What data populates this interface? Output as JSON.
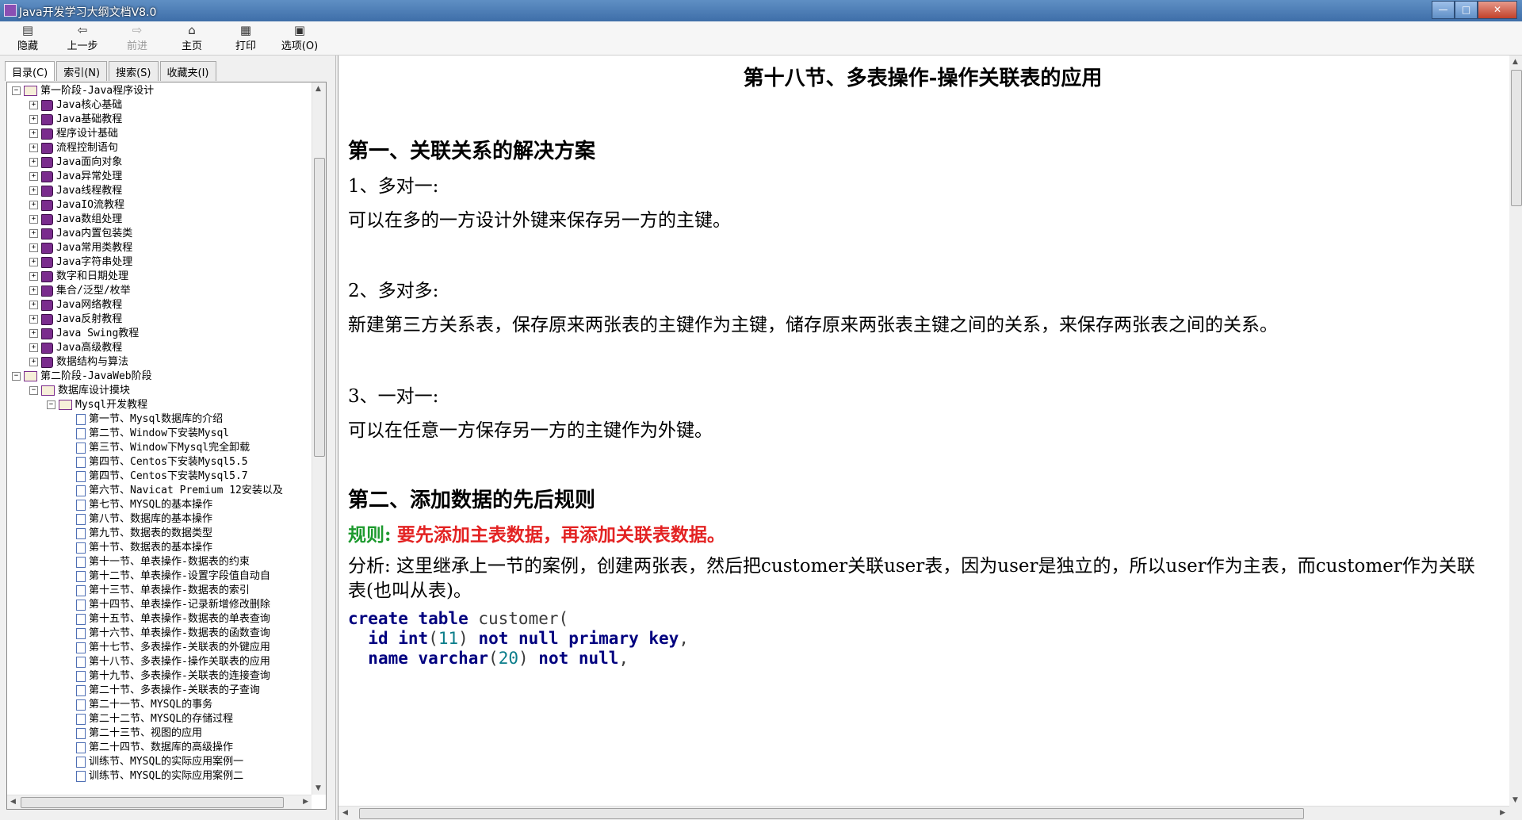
{
  "window": {
    "title": "Java开发学习大纲文档V8.0",
    "min": "—",
    "max": "□",
    "close": "✕"
  },
  "toolbar": {
    "hide": "隐藏",
    "back": "上一步",
    "forward": "前进",
    "home": "主页",
    "print": "打印",
    "options": "选项(O)"
  },
  "tabs": [
    "目录(C)",
    "索引(N)",
    "搜索(S)",
    "收藏夹(I)"
  ],
  "tree": [
    {
      "label": "第一阶段-Java程序设计",
      "level": 0,
      "type": "open",
      "expander": "⊟"
    },
    {
      "label": "Java核心基础",
      "level": 1,
      "type": "book",
      "expander": "⊞"
    },
    {
      "label": "Java基础教程",
      "level": 1,
      "type": "book",
      "expander": "⊞"
    },
    {
      "label": "程序设计基础",
      "level": 1,
      "type": "book",
      "expander": "⊞"
    },
    {
      "label": "流程控制语句",
      "level": 1,
      "type": "book",
      "expander": "⊞"
    },
    {
      "label": "Java面向对象",
      "level": 1,
      "type": "book",
      "expander": "⊞"
    },
    {
      "label": "Java异常处理",
      "level": 1,
      "type": "book",
      "expander": "⊞"
    },
    {
      "label": "Java线程教程",
      "level": 1,
      "type": "book",
      "expander": "⊞"
    },
    {
      "label": "JavaIO流教程",
      "level": 1,
      "type": "book",
      "expander": "⊞"
    },
    {
      "label": "Java数组处理",
      "level": 1,
      "type": "book",
      "expander": "⊞"
    },
    {
      "label": "Java内置包装类",
      "level": 1,
      "type": "book",
      "expander": "⊞"
    },
    {
      "label": "Java常用类教程",
      "level": 1,
      "type": "book",
      "expander": "⊞"
    },
    {
      "label": "Java字符串处理",
      "level": 1,
      "type": "book",
      "expander": "⊞"
    },
    {
      "label": "数字和日期处理",
      "level": 1,
      "type": "book",
      "expander": "⊞"
    },
    {
      "label": "集合/泛型/枚举",
      "level": 1,
      "type": "book",
      "expander": "⊞"
    },
    {
      "label": "Java网络教程",
      "level": 1,
      "type": "book",
      "expander": "⊞"
    },
    {
      "label": "Java反射教程",
      "level": 1,
      "type": "book",
      "expander": "⊞"
    },
    {
      "label": "Java Swing教程",
      "level": 1,
      "type": "book",
      "expander": "⊞"
    },
    {
      "label": "Java高级教程",
      "level": 1,
      "type": "book",
      "expander": "⊞"
    },
    {
      "label": "数据结构与算法",
      "level": 1,
      "type": "book",
      "expander": "⊞"
    },
    {
      "label": "第二阶段-JavaWeb阶段",
      "level": 0,
      "type": "open",
      "expander": "⊟"
    },
    {
      "label": "数据库设计摸块",
      "level": 1,
      "type": "open",
      "expander": "⊟"
    },
    {
      "label": "Mysql开发教程",
      "level": 2,
      "type": "open",
      "expander": "⊟"
    },
    {
      "label": "第一节、Mysql数据库的介绍",
      "level": 3,
      "type": "page",
      "expander": ""
    },
    {
      "label": "第二节、Window下安装Mysql",
      "level": 3,
      "type": "page",
      "expander": ""
    },
    {
      "label": "第三节、Window下Mysql完全卸载",
      "level": 3,
      "type": "page",
      "expander": ""
    },
    {
      "label": "第四节、Centos下安装Mysql5.5",
      "level": 3,
      "type": "page",
      "expander": ""
    },
    {
      "label": "第四节、Centos下安装Mysql5.7",
      "level": 3,
      "type": "page",
      "expander": ""
    },
    {
      "label": "第六节、Navicat Premium 12安装以及",
      "level": 3,
      "type": "page",
      "expander": ""
    },
    {
      "label": "第七节、MYSQL的基本操作",
      "level": 3,
      "type": "page",
      "expander": ""
    },
    {
      "label": "第八节、数据库的基本操作",
      "level": 3,
      "type": "page",
      "expander": ""
    },
    {
      "label": "第九节、数据表的数据类型",
      "level": 3,
      "type": "page",
      "expander": ""
    },
    {
      "label": "第十节、数据表的基本操作",
      "level": 3,
      "type": "page",
      "expander": ""
    },
    {
      "label": "第十一节、单表操作-数据表的约束",
      "level": 3,
      "type": "page",
      "expander": ""
    },
    {
      "label": "第十二节、单表操作-设置字段值自动自",
      "level": 3,
      "type": "page",
      "expander": ""
    },
    {
      "label": "第十三节、单表操作-数据表的索引",
      "level": 3,
      "type": "page",
      "expander": ""
    },
    {
      "label": "第十四节、单表操作-记录新增修改删除",
      "level": 3,
      "type": "page",
      "expander": ""
    },
    {
      "label": "第十五节、单表操作-数据表的单表查询",
      "level": 3,
      "type": "page",
      "expander": ""
    },
    {
      "label": "第十六节、单表操作-数据表的函数查询",
      "level": 3,
      "type": "page",
      "expander": ""
    },
    {
      "label": "第十七节、多表操作-关联表的外键应用",
      "level": 3,
      "type": "page",
      "expander": ""
    },
    {
      "label": "第十八节、多表操作-操作关联表的应用",
      "level": 3,
      "type": "page",
      "expander": ""
    },
    {
      "label": "第十九节、多表操作-关联表的连接查询",
      "level": 3,
      "type": "page",
      "expander": ""
    },
    {
      "label": "第二十节、多表操作-关联表的子查询",
      "level": 3,
      "type": "page",
      "expander": ""
    },
    {
      "label": "第二十一节、MYSQL的事务",
      "level": 3,
      "type": "page",
      "expander": ""
    },
    {
      "label": "第二十二节、MYSQL的存储过程",
      "level": 3,
      "type": "page",
      "expander": ""
    },
    {
      "label": "第二十三节、视图的应用",
      "level": 3,
      "type": "page",
      "expander": ""
    },
    {
      "label": "第二十四节、数据库的高级操作",
      "level": 3,
      "type": "page",
      "expander": ""
    },
    {
      "label": "训练节、MYSQL的实际应用案例一",
      "level": 3,
      "type": "page",
      "expander": ""
    },
    {
      "label": "训练节、MYSQL的实际应用案例二",
      "level": 3,
      "type": "page",
      "expander": ""
    }
  ],
  "doc": {
    "title": "第十八节、多表操作-操作关联表的应用",
    "section1": "第一、关联关系的解决方案",
    "item1": "1、多对一:",
    "item1_text": "可以在多的一方设计外键来保存另一方的主键。",
    "item2": "2、多对多:",
    "item2_text": "新建第三方关系表，保存原来两张表的主键作为主键，储存原来两张表主键之间的关系，来保存两张表之间的关系。",
    "item3": "3、一对一:",
    "item3_text": "可以在任意一方保存另一方的主键作为外键。",
    "section2": "第二、添加数据的先后规则",
    "rule_label": "规则:",
    "rule_text": "要先添加主表数据，再添加关联表数据。",
    "analysis": "分析: 这里继承上一节的案例，创建两张表，然后把customer关联user表，因为user是独立的，所以user作为主表，而customer作为关联表(也叫从表)。",
    "code": {
      "l1_kw": "create table",
      "l1_rest": " customer(",
      "l2_name": "id",
      "l2_type": "int",
      "l2_arg": "11",
      "l2_tail": "not null primary key",
      "l3_name": "name",
      "l3_type": "varchar",
      "l3_arg": "20",
      "l3_tail": "not null"
    }
  }
}
